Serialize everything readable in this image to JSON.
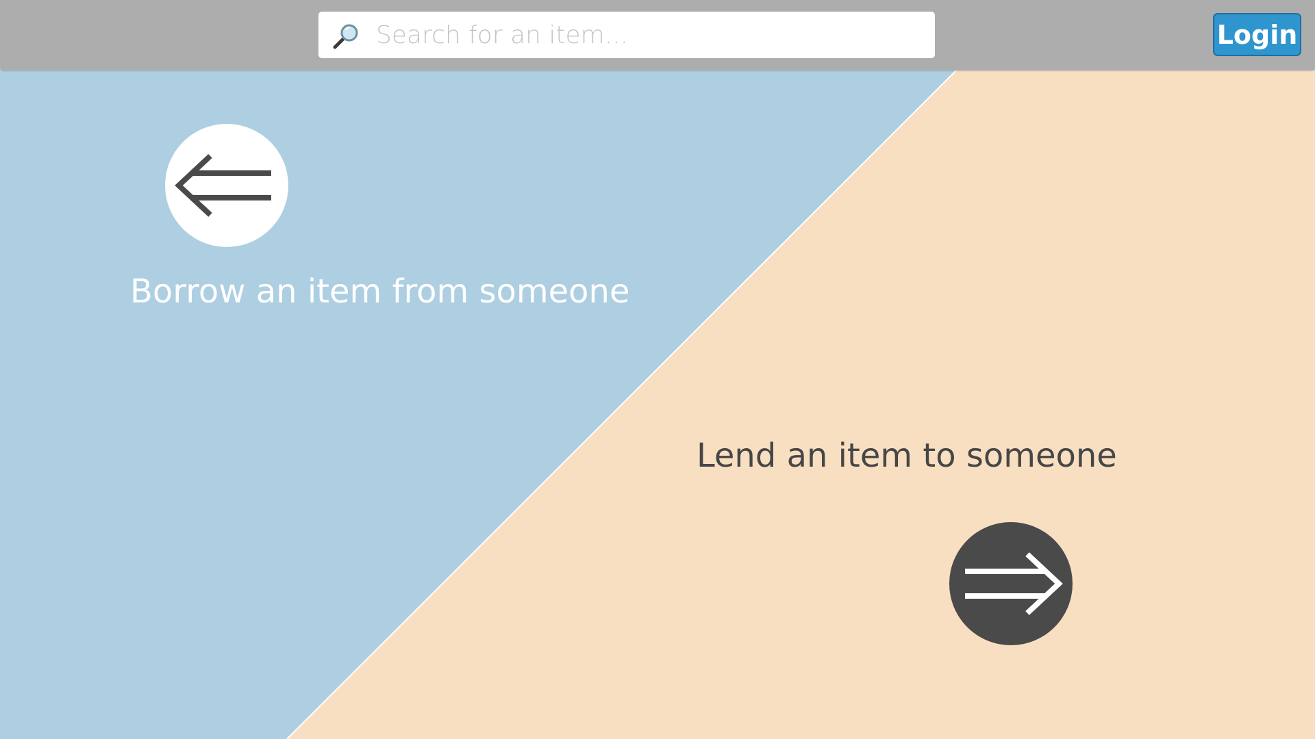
{
  "colors": {
    "borrow_panel": "#aecee1",
    "lend_panel": "#f9dfc2",
    "topbar": "#adadad",
    "login_button": "#2f95cf",
    "borrow_icon_bg": "#ffffff",
    "lend_icon_bg": "#4a4a4a",
    "dark_text": "#464646"
  },
  "header": {
    "search": {
      "icon": "magnifier-icon",
      "placeholder": "Search for an item...",
      "value": ""
    },
    "login_label": "Login"
  },
  "borrow": {
    "icon": "arrow-left-icon",
    "label": "Borrow an item from someone"
  },
  "lend": {
    "icon": "arrow-right-icon",
    "label": "Lend an item to someone"
  }
}
